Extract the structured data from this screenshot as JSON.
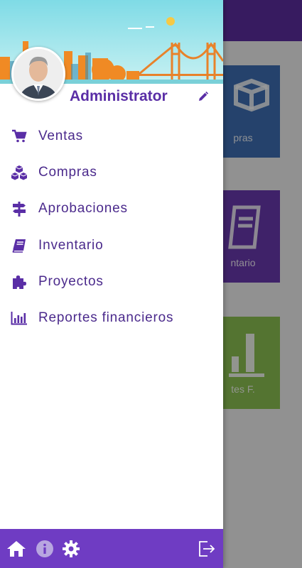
{
  "user": {
    "name": "Administrator"
  },
  "menu": {
    "items": [
      {
        "label": "Ventas",
        "icon": "cart-icon"
      },
      {
        "label": "Compras",
        "icon": "boxes-icon"
      },
      {
        "label": "Aprobaciones",
        "icon": "signpost-icon"
      },
      {
        "label": "Inventario",
        "icon": "book-icon"
      },
      {
        "label": "Proyectos",
        "icon": "puzzle-icon"
      },
      {
        "label": "Reportes financieros",
        "icon": "bar-chart-icon"
      }
    ]
  },
  "background_tiles": [
    {
      "label": "pras"
    },
    {
      "label": "ntario"
    },
    {
      "label": "tes F."
    }
  ],
  "colors": {
    "primary": "#6f3cc3",
    "appbar": "#5c2ea0",
    "text_purple": "#4b2a8c",
    "tile_blue": "#3f6fb5",
    "tile_purple": "#6a39b0",
    "tile_green": "#8cc152"
  }
}
